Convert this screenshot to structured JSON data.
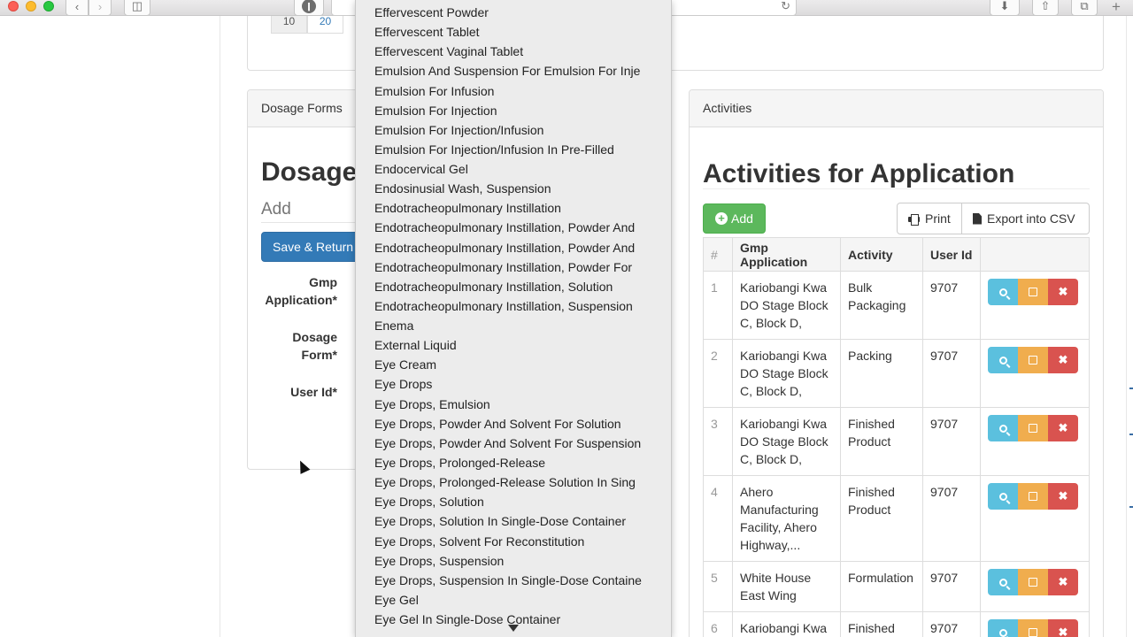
{
  "browser": {
    "back_icon": "chevron-left-icon",
    "forward_icon": "chevron-right-icon",
    "sidebar_icon": "sidebar-icon",
    "reload_icon": "reload-icon",
    "download_icon": "download-icon",
    "share_icon": "share-icon",
    "tabs_icon": "tabs-icon",
    "new_tab_icon": "plus-icon"
  },
  "pager": [
    "10",
    "20"
  ],
  "dosage_panel": {
    "heading": "Dosage Forms",
    "title": "Dosage",
    "input_placeholder": "Add",
    "save_label": "Save & Return",
    "labels": {
      "gmp_line1": "Gmp",
      "gmp_line2": "Application*",
      "dosage_line1": "Dosage",
      "dosage_line2": "Form*",
      "user": "User Id*"
    }
  },
  "dropdown": {
    "items": [
      "Effervescent Powder",
      "Effervescent Tablet",
      "Effervescent Vaginal Tablet",
      "Emulsion And Suspension For Emulsion For Inje",
      "Emulsion For Infusion",
      "Emulsion For Injection",
      "Emulsion For Injection/Infusion",
      "Emulsion For Injection/Infusion In Pre-Filled",
      "Endocervical Gel",
      "Endosinusial Wash, Suspension",
      "Endotracheopulmonary Instillation",
      "Endotracheopulmonary Instillation, Powder And",
      "Endotracheopulmonary Instillation, Powder And",
      "Endotracheopulmonary Instillation, Powder For",
      "Endotracheopulmonary Instillation, Solution",
      "Endotracheopulmonary Instillation, Suspension",
      "Enema",
      "External Liquid",
      "Eye Cream",
      "Eye Drops",
      "Eye Drops, Emulsion",
      "Eye Drops, Powder And Solvent For Solution",
      "Eye Drops, Powder And Solvent For Suspension",
      "Eye Drops, Prolonged-Release",
      "Eye Drops, Prolonged-Release Solution In Sing",
      "Eye Drops, Solution",
      "Eye Drops, Solution In Single-Dose Container",
      "Eye Drops, Solvent For Reconstitution",
      "Eye Drops, Suspension",
      "Eye Drops, Suspension In Single-Dose Containe",
      "Eye Gel",
      "Eye Gel In Single-Dose Container"
    ]
  },
  "activities_panel": {
    "heading": "Activities",
    "title": "Activities for Application",
    "add_label": "Add",
    "print_label": "Print",
    "export_label": "Export into CSV",
    "columns": [
      "#",
      "Gmp Application",
      "Activity",
      "User Id"
    ],
    "rows": [
      {
        "num": "1",
        "app": "Kariobangi Kwa DO Stage Block C, Block D,",
        "activity": "Bulk Packaging",
        "user": "9707"
      },
      {
        "num": "2",
        "app": "Kariobangi Kwa DO Stage Block C, Block D,",
        "activity": "Packing",
        "user": "9707"
      },
      {
        "num": "3",
        "app": "Kariobangi Kwa DO Stage Block C, Block D,",
        "activity": "Finished Product",
        "user": "9707"
      },
      {
        "num": "4",
        "app": "Ahero Manufacturing Facility, Ahero Highway,...",
        "activity": "Finished Product",
        "user": "9707"
      },
      {
        "num": "5",
        "app": "White House East Wing",
        "activity": "Formulation",
        "user": "9707"
      },
      {
        "num": "6",
        "app": "Kariobangi Kwa",
        "activity": "Finished",
        "user": "9707"
      }
    ]
  },
  "colors": {
    "primary": "#337ab7",
    "success": "#5cb85c",
    "info": "#5bc0de",
    "warning": "#f0ad4e",
    "danger": "#d9534f"
  }
}
